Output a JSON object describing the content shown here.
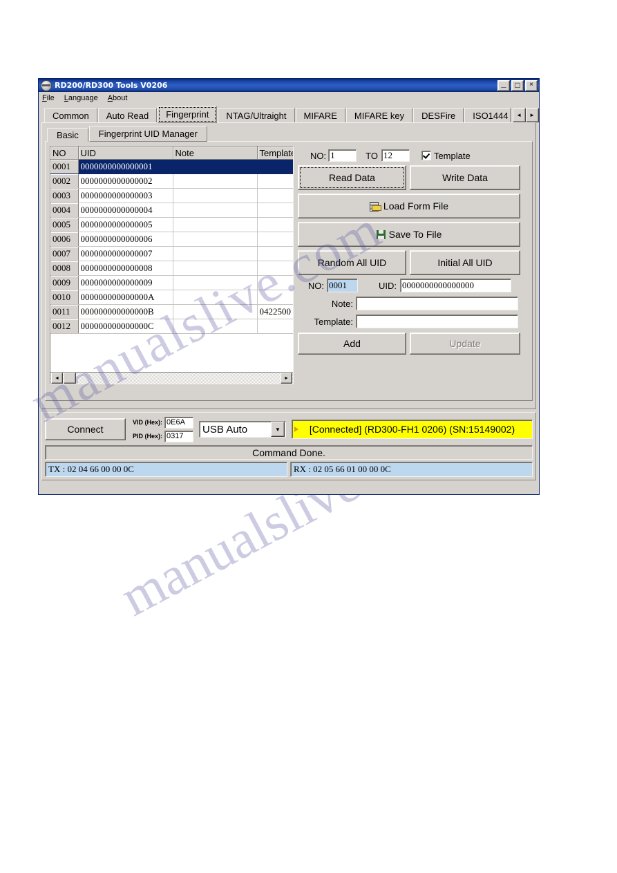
{
  "window": {
    "title": "RD200/RD300 Tools V0206",
    "icon": "app-globe-icon",
    "minimize": "_",
    "maximize": "□",
    "close": "×"
  },
  "menubar": {
    "items": [
      {
        "label": "File",
        "accel": "F"
      },
      {
        "label": "Language",
        "accel": "L"
      },
      {
        "label": "About",
        "accel": "A"
      }
    ]
  },
  "main_tabs": {
    "active": "Fingerprint",
    "items": [
      {
        "label": "Common"
      },
      {
        "label": "Auto Read"
      },
      {
        "label": "Fingerprint"
      },
      {
        "label": "NTAG/Ultraight"
      },
      {
        "label": "MIFARE"
      },
      {
        "label": "MIFARE key"
      },
      {
        "label": "DESFire"
      },
      {
        "label": "ISO1444"
      }
    ],
    "scroll_left": "◄",
    "scroll_right": "►"
  },
  "sub_tabs": {
    "active": "Fingerprint UID Manager",
    "items": [
      {
        "label": "Basic"
      },
      {
        "label": "Fingerprint UID Manager"
      }
    ]
  },
  "grid": {
    "columns": [
      "NO",
      "UID",
      "Note",
      "Template"
    ],
    "selected_row": 0,
    "rows": [
      {
        "no": "0001",
        "uid": "0000000000000001",
        "note": "",
        "template": ""
      },
      {
        "no": "0002",
        "uid": "0000000000000002",
        "note": "",
        "template": ""
      },
      {
        "no": "0003",
        "uid": "0000000000000003",
        "note": "",
        "template": ""
      },
      {
        "no": "0004",
        "uid": "0000000000000004",
        "note": "",
        "template": ""
      },
      {
        "no": "0005",
        "uid": "0000000000000005",
        "note": "",
        "template": ""
      },
      {
        "no": "0006",
        "uid": "0000000000000006",
        "note": "",
        "template": ""
      },
      {
        "no": "0007",
        "uid": "0000000000000007",
        "note": "",
        "template": ""
      },
      {
        "no": "0008",
        "uid": "0000000000000008",
        "note": "",
        "template": ""
      },
      {
        "no": "0009",
        "uid": "0000000000000009",
        "note": "",
        "template": ""
      },
      {
        "no": "0010",
        "uid": "000000000000000A",
        "note": "",
        "template": ""
      },
      {
        "no": "0011",
        "uid": "000000000000000B",
        "note": "",
        "template": "0422500"
      },
      {
        "no": "0012",
        "uid": "000000000000000C",
        "note": "",
        "template": ""
      }
    ],
    "hscroll_left": "◄",
    "hscroll_right": "►"
  },
  "range": {
    "no_label": "NO:",
    "no_value": "1",
    "to_label": "TO",
    "to_value": "12",
    "template_checkbox_label": "Template",
    "template_checked": true
  },
  "actions": {
    "read_data": "Read Data",
    "write_data": "Write Data",
    "load_form_file": "Load Form File",
    "save_to_file": "Save To File",
    "random_all_uid": "Random All UID",
    "initial_all_uid": "Initial All UID",
    "add": "Add",
    "update": "Update",
    "load_icon": "folder-icon",
    "save_icon": "floppy-disk-icon"
  },
  "record": {
    "no_label": "NO:",
    "no_value": "0001",
    "uid_label": "UID:",
    "uid_value": "0000000000000000",
    "note_label": "Note:",
    "note_value": "",
    "template_label": "Template:",
    "template_value": ""
  },
  "connection": {
    "connect_button": "Connect",
    "vid_label": "VID (Hex):",
    "vid_value": "0E6A",
    "pid_label": "PID (Hex):",
    "pid_value": "0317",
    "interface_selected": "USB Auto",
    "interface_options": [
      "USB Auto"
    ],
    "dropdown_arrow": "▼",
    "status_banner": "[Connected] (RD300-FH1   0206) (SN:15149002)",
    "status_banner_bg": "#ffff00"
  },
  "statusbar": {
    "command": "Command Done.",
    "tx": "TX : 02 04 66 00 00 0C",
    "rx": "RX : 02 05 66 01 00 00 0C"
  },
  "watermark": {
    "line1": "manualslive.com",
    "line2": "manualslive.com"
  }
}
